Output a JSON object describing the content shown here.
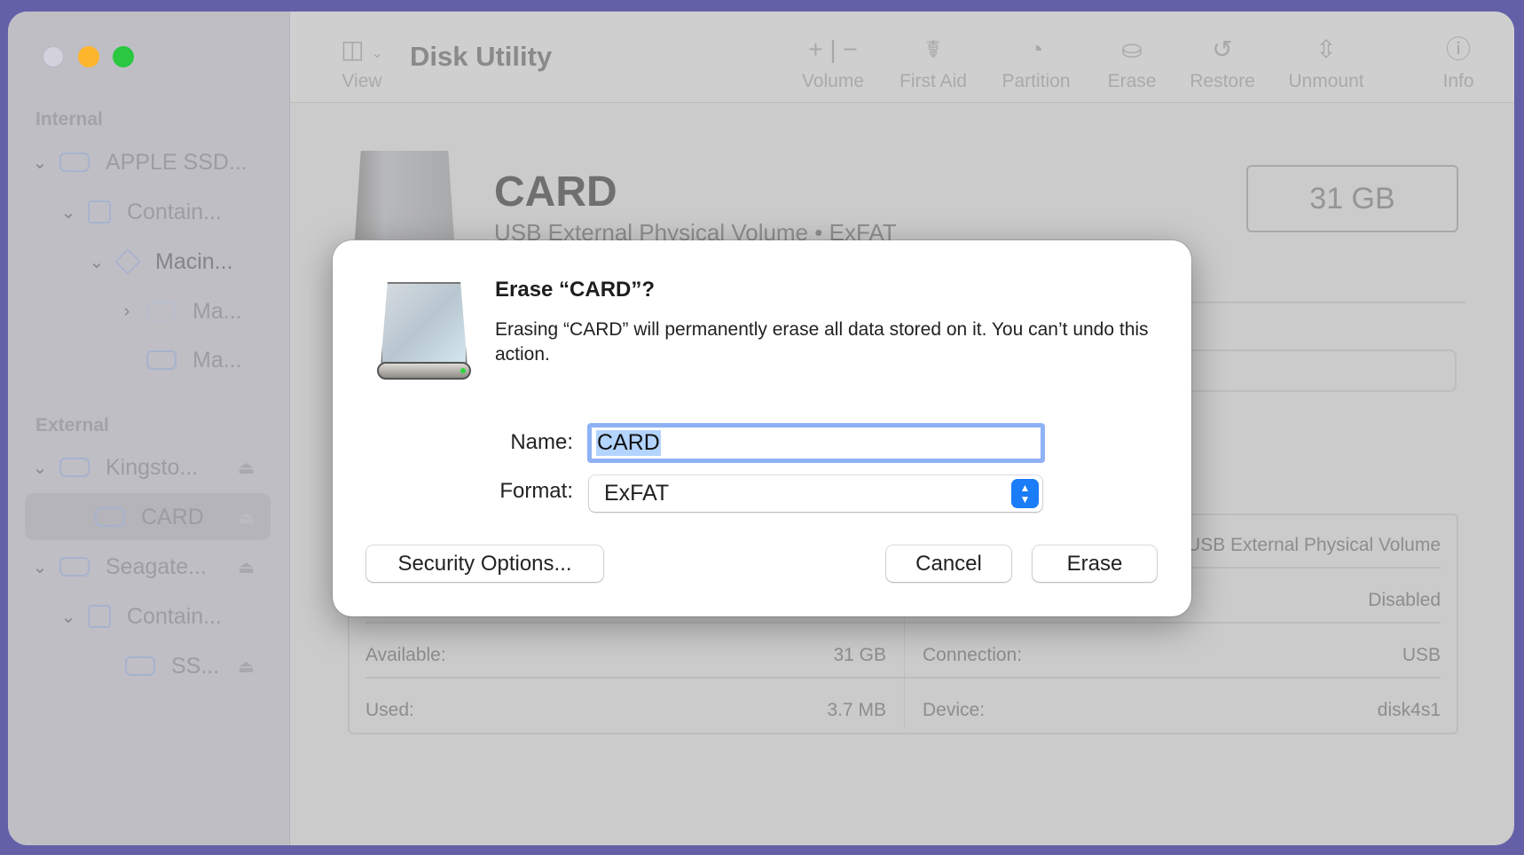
{
  "window": {
    "title": "Disk Utility",
    "traffic_lights": {
      "close": "#d3d2dc",
      "minimize": "#fdb52d",
      "zoom": "#2ac840"
    }
  },
  "toolbar": {
    "view_label": "View",
    "items": [
      {
        "icon": "plus-minus-icon",
        "label": "Volume"
      },
      {
        "icon": "stethoscope-icon",
        "label": "First Aid"
      },
      {
        "icon": "pie-chart-icon",
        "label": "Partition"
      },
      {
        "icon": "erase-drive-icon",
        "label": "Erase"
      },
      {
        "icon": "restore-icon",
        "label": "Restore"
      },
      {
        "icon": "unmount-icon",
        "label": "Unmount"
      },
      {
        "icon": "info-icon",
        "label": "Info"
      }
    ]
  },
  "sidebar": {
    "internal_label": "Internal",
    "external_label": "External",
    "internal": [
      {
        "name": "APPLE SSD..."
      },
      {
        "name": "Contain..."
      },
      {
        "name": "Macin..."
      },
      {
        "name": "Ma..."
      },
      {
        "name": "Ma..."
      }
    ],
    "external": [
      {
        "name": "Kingsto..."
      },
      {
        "name": "CARD"
      },
      {
        "name": "Seagate..."
      },
      {
        "name": "Contain..."
      },
      {
        "name": "SS..."
      }
    ]
  },
  "volume": {
    "name": "CARD",
    "subtitle": "USB External Physical Volume • ExFAT",
    "size": "31 GB",
    "info": {
      "type_value": "USB External Physical Volume",
      "owners_value": "Disabled",
      "available_label": "Available:",
      "available_value": "31 GB",
      "used_label": "Used:",
      "used_value": "3.7 MB",
      "connection_label": "Connection:",
      "connection_value": "USB",
      "device_label": "Device:",
      "device_value": "disk4s1"
    }
  },
  "dialog": {
    "title": "Erase “CARD”?",
    "message": "Erasing “CARD” will permanently erase all data stored on it. You can’t undo this action.",
    "name_label": "Name:",
    "name_value": "CARD",
    "format_label": "Format:",
    "format_value": "ExFAT",
    "security_button": "Security Options...",
    "cancel_button": "Cancel",
    "erase_button": "Erase"
  }
}
